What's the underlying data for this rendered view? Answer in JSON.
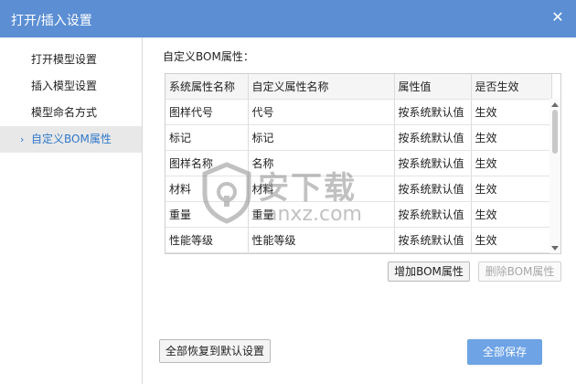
{
  "window": {
    "title": "打开/插入设置",
    "close_glyph": "✕"
  },
  "sidebar": {
    "items": [
      {
        "label": "打开模型设置",
        "active": false
      },
      {
        "label": "插入模型设置",
        "active": false
      },
      {
        "label": "模型命名方式",
        "active": false
      },
      {
        "label": "自定义BOM属性",
        "active": true
      }
    ],
    "active_chevron": "›"
  },
  "main": {
    "section_label": "自定义BOM属性：",
    "table": {
      "columns": [
        "系统属性名称",
        "自定义属性名称",
        "属性值",
        "是否生效"
      ],
      "rows": [
        [
          "图样代号",
          "代号",
          "按系统默认值",
          "生效"
        ],
        [
          "标记",
          "标记",
          "按系统默认值",
          "生效"
        ],
        [
          "图样名称",
          "名称",
          "按系统默认值",
          "生效"
        ],
        [
          "材料",
          "材料",
          "按系统默认值",
          "生效"
        ],
        [
          "重量",
          "重量",
          "按系统默认值",
          "生效"
        ],
        [
          "性能等级",
          "性能等级",
          "按系统默认值",
          "生效"
        ]
      ]
    },
    "add_button": "增加BOM属性",
    "delete_button": "删除BOM属性",
    "restore_button": "全部恢复到默认设置",
    "save_button": "全部保存"
  },
  "watermark": {
    "text": "安下载",
    "url": "anxz.com"
  },
  "colors": {
    "titlebar": "#5b8ed3",
    "accent": "#2f78c9",
    "primary_button": "#6ea3e6"
  }
}
